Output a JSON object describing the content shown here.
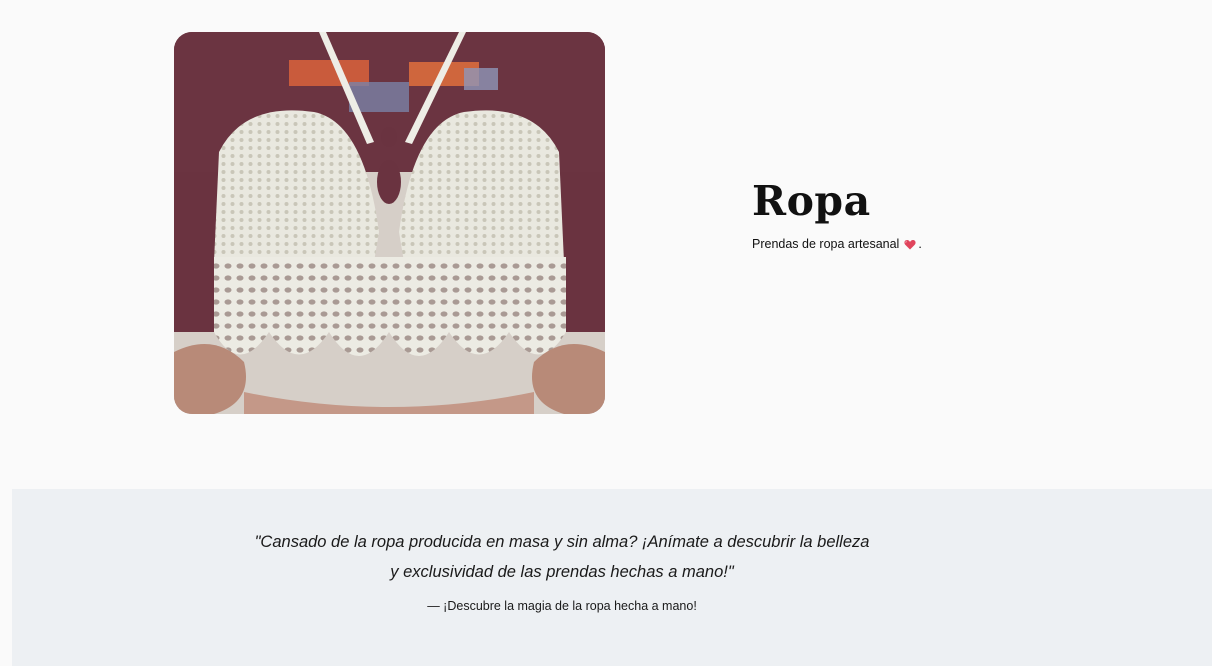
{
  "hero": {
    "title": "Ropa",
    "subtitle": "Prendas de ropa artesanal",
    "subtitle_icon": "heart-icon",
    "subtitle_end": ".",
    "image_icon": "crochet-top-photo"
  },
  "quote": {
    "line1": "\"Cansado de la ropa producida en masa y sin alma? ¡Anímate a descubrir la belleza",
    "line2": "y exclusividad de las prendas hechas a mano!\"",
    "attribution": "— ¡Descubre la magia de la ropa hecha a mano!"
  },
  "colors": {
    "page_background": "#fafafa",
    "quote_background": "#edf0f3",
    "heart": "#e0445c"
  }
}
